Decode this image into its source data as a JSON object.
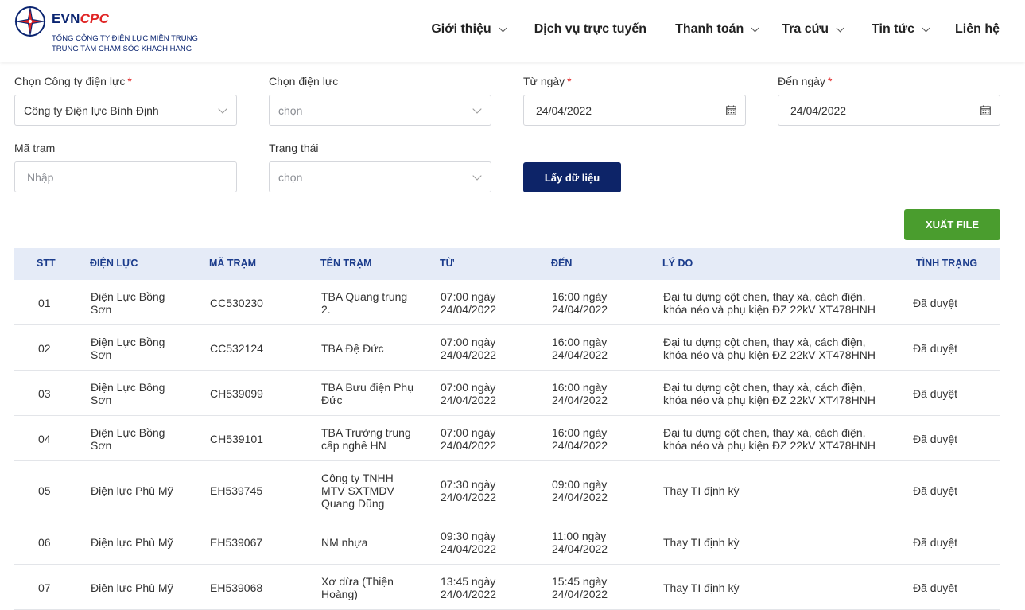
{
  "header": {
    "brand_evn": "EVN",
    "brand_cpc": "CPC",
    "company_line1": "TỔNG CÔNG TY ĐIỆN LỰC MIỀN TRUNG",
    "company_line2": "TRUNG TÂM CHĂM SÓC KHÁCH HÀNG",
    "nav": [
      {
        "label": "Giới thiệu",
        "has_dropdown": true
      },
      {
        "label": "Dịch vụ trực tuyến",
        "has_dropdown": false
      },
      {
        "label": "Thanh toán",
        "has_dropdown": true
      },
      {
        "label": "Tra cứu",
        "has_dropdown": true
      },
      {
        "label": "Tin tức",
        "has_dropdown": true
      },
      {
        "label": "Liên hệ",
        "has_dropdown": false
      }
    ]
  },
  "form": {
    "company": {
      "label": "Chọn Công ty điện lực",
      "required": "*",
      "value": "Công ty Điện lực Bình Định"
    },
    "electric": {
      "label": "Chọn điện lực",
      "placeholder": "chọn"
    },
    "from_date": {
      "label": "Từ ngày",
      "required": "*",
      "value": "24/04/2022"
    },
    "to_date": {
      "label": "Đến ngày",
      "required": "*",
      "value": "24/04/2022"
    },
    "station_code": {
      "label": "Mã trạm",
      "placeholder": "Nhập"
    },
    "status": {
      "label": "Trạng thái",
      "placeholder": "chọn"
    },
    "submit_label": "Lấy dữ liệu",
    "export_label": "XUẤT FILE"
  },
  "table": {
    "columns": [
      "STT",
      "ĐIỆN LỰC",
      "MÃ TRẠM",
      "TÊN TRẠM",
      "TỪ",
      "ĐẾN",
      "LÝ DO",
      "TÌNH TRẠNG"
    ],
    "rows": [
      {
        "stt": "01",
        "dien_luc": [
          "Điện Lực Bồng",
          "Sơn"
        ],
        "ma_tram": "CC530230",
        "ten_tram": [
          "TBA Quang trung",
          "2."
        ],
        "tu": [
          "07:00 ngày",
          "24/04/2022"
        ],
        "den": [
          "16:00 ngày",
          "24/04/2022"
        ],
        "ly_do": [
          "Đại tu dựng cột chen, thay xà, cách điện,",
          "khóa néo và phụ kiện ĐZ 22kV XT478HNH"
        ],
        "tinh_trang": "Đã duyệt"
      },
      {
        "stt": "02",
        "dien_luc": [
          "Điện Lực Bồng",
          "Sơn"
        ],
        "ma_tram": "CC532124",
        "ten_tram": [
          "TBA Đệ Đức"
        ],
        "tu": [
          "07:00 ngày",
          "24/04/2022"
        ],
        "den": [
          "16:00 ngày",
          "24/04/2022"
        ],
        "ly_do": [
          "Đại tu dựng cột chen, thay xà, cách điện,",
          "khóa néo và phụ kiện ĐZ 22kV XT478HNH"
        ],
        "tinh_trang": "Đã duyệt"
      },
      {
        "stt": "03",
        "dien_luc": [
          "Điện Lực Bồng",
          "Sơn"
        ],
        "ma_tram": "CH539099",
        "ten_tram": [
          "TBA Bưu điện Phụ",
          "Đức"
        ],
        "tu": [
          "07:00 ngày",
          "24/04/2022"
        ],
        "den": [
          "16:00 ngày",
          "24/04/2022"
        ],
        "ly_do": [
          "Đại tu dựng cột chen, thay xà, cách điện,",
          "khóa néo và phụ kiện ĐZ 22kV XT478HNH"
        ],
        "tinh_trang": "Đã duyệt"
      },
      {
        "stt": "04",
        "dien_luc": [
          "Điện Lực Bồng",
          "Sơn"
        ],
        "ma_tram": "CH539101",
        "ten_tram": [
          "TBA Trường trung",
          "cấp nghề HN"
        ],
        "tu": [
          "07:00 ngày",
          "24/04/2022"
        ],
        "den": [
          "16:00 ngày",
          "24/04/2022"
        ],
        "ly_do": [
          "Đại tu dựng cột chen, thay xà, cách điện,",
          "khóa néo và phụ kiện ĐZ 22kV XT478HNH"
        ],
        "tinh_trang": "Đã duyệt"
      },
      {
        "stt": "05",
        "dien_luc": [
          "Điện lực Phù Mỹ"
        ],
        "ma_tram": "EH539745",
        "ten_tram": [
          "Công ty TNHH",
          "MTV SXTMDV",
          "Quang Dũng"
        ],
        "tu": [
          "07:30 ngày",
          "24/04/2022"
        ],
        "den": [
          "09:00 ngày",
          "24/04/2022"
        ],
        "ly_do": [
          "Thay TI định kỳ"
        ],
        "tinh_trang": "Đã duyệt"
      },
      {
        "stt": "06",
        "dien_luc": [
          "Điện lực Phù Mỹ"
        ],
        "ma_tram": "EH539067",
        "ten_tram": [
          "NM nhựa"
        ],
        "tu": [
          "09:30 ngày",
          "24/04/2022"
        ],
        "den": [
          "11:00 ngày",
          "24/04/2022"
        ],
        "ly_do": [
          "Thay TI định kỳ"
        ],
        "tinh_trang": "Đã duyệt"
      },
      {
        "stt": "07",
        "dien_luc": [
          "Điện lực Phù Mỹ"
        ],
        "ma_tram": "EH539068",
        "ten_tram": [
          "Xơ dừa (Thiện",
          "Hoàng)"
        ],
        "tu": [
          "13:45 ngày",
          "24/04/2022"
        ],
        "den": [
          "15:45 ngày",
          "24/04/2022"
        ],
        "ly_do": [
          "Thay TI định kỳ"
        ],
        "tinh_trang": "Đã duyệt"
      }
    ]
  }
}
